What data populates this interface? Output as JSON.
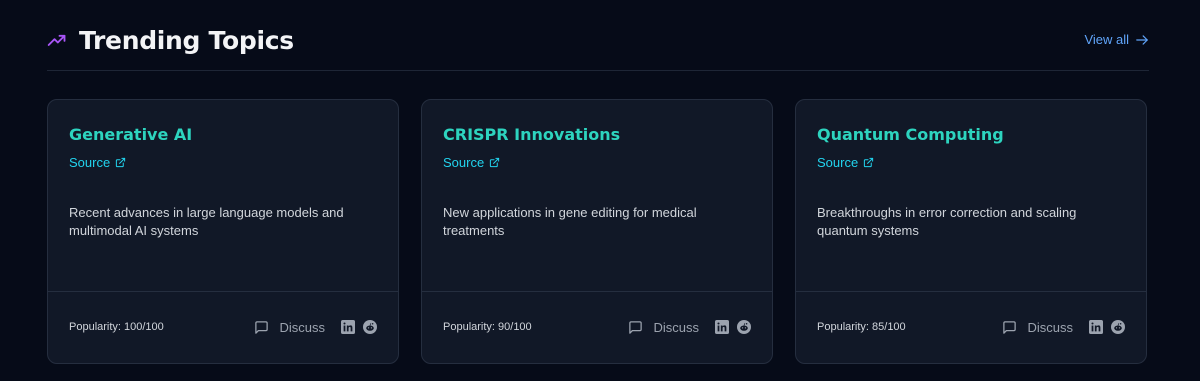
{
  "header": {
    "title": "Trending Topics",
    "title_icon": "trending-up-icon",
    "view_all_label": "View all",
    "view_all_icon": "arrow-right-icon"
  },
  "colors": {
    "background": "#060b18",
    "card_background": "#111827",
    "title_accent": "#a855f7",
    "topic_title": "#2dd4bf",
    "link": "#22d3ee",
    "view_all": "#60a5fa"
  },
  "topics": [
    {
      "title": "Generative AI",
      "source_label": "Source",
      "description": "Recent advances in large language models and multimodal AI systems",
      "popularity": "Popularity: 100/100",
      "discuss_label": "Discuss"
    },
    {
      "title": "CRISPR Innovations",
      "source_label": "Source",
      "description": "New applications in gene editing for medical treatments",
      "popularity": "Popularity: 90/100",
      "discuss_label": "Discuss"
    },
    {
      "title": "Quantum Computing",
      "source_label": "Source",
      "description": "Breakthroughs in error correction and scaling quantum systems",
      "popularity": "Popularity: 85/100",
      "discuss_label": "Discuss"
    }
  ],
  "icons": {
    "source": "external-link-icon",
    "discuss": "message-square-icon",
    "share_1": "linkedin-icon",
    "share_2": "reddit-icon"
  }
}
